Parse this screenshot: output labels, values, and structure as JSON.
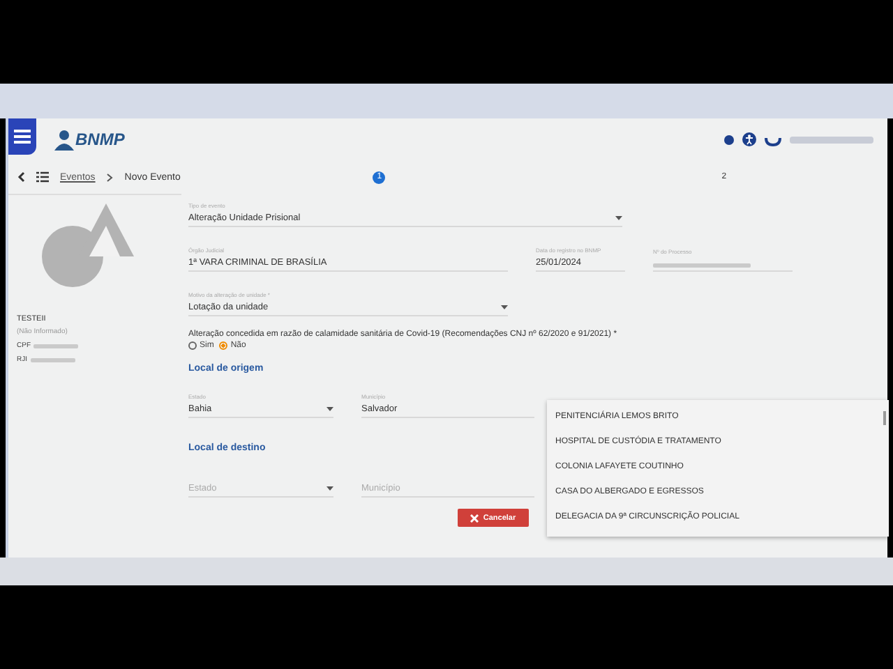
{
  "header": {
    "logo": "BNMP"
  },
  "breadcrumb": {
    "items": [
      "Eventos",
      "Novo Evento"
    ]
  },
  "stepper": [
    {
      "label": "1",
      "selected": true
    },
    {
      "label": "2",
      "selected": false
    }
  ],
  "profile": {
    "name": "TESTEII",
    "status": "(Não Informado)",
    "ids": [
      {
        "label": "CPF"
      },
      {
        "label": "RJI"
      }
    ]
  },
  "fields_top": [
    {
      "label": "Tipo de evento",
      "value": "Alteração Unidade Prisional",
      "kind": "select"
    },
    {
      "label": "Órgão Judicial",
      "value": "1ª VARA CRIMINAL DE BRASÍLIA",
      "kind": "text"
    },
    {
      "label": "Data do registro no BNMP",
      "value": "25/01/2024",
      "kind": "text"
    },
    {
      "label": "Nº do Processo",
      "kind": "redacted"
    },
    {
      "label": "Motivo da alteração de unidade *",
      "value": "Lotação da unidade",
      "kind": "select"
    }
  ],
  "covid": {
    "question": "Alteração concedida em razão de calamidade sanitária de Covid-19 (Recomendações CNJ nº 62/2020 e 91/2021) *",
    "options": [
      {
        "label": "Sim",
        "selected": false
      },
      {
        "label": "Não",
        "selected": true
      }
    ]
  },
  "sections": [
    {
      "title": "Local de origem",
      "fields": [
        {
          "label": "Estado",
          "value": "Bahia",
          "kind": "select"
        },
        {
          "label": "Município",
          "value": "Salvador",
          "kind": "text"
        },
        {
          "kind": "focused"
        }
      ]
    },
    {
      "title": "Local de destino",
      "fields": [
        {
          "placeholder": "Estado",
          "kind": "select"
        },
        {
          "placeholder": "Município",
          "kind": "text"
        }
      ]
    }
  ],
  "dropdown": {
    "options": [
      "PENITENCIÁRIA LEMOS BRITO",
      "HOSPITAL DE CUSTÓDIA E TRATAMENTO",
      "COLONIA LAFAYETE COUTINHO",
      "CASA DO ALBERGADO E EGRESSOS",
      "DELEGACIA DA 9ª CIRCUNSCRIÇÃO POLICIAL"
    ]
  },
  "buttons": [
    {
      "label": "Cancelar",
      "kind": "cancel"
    }
  ]
}
